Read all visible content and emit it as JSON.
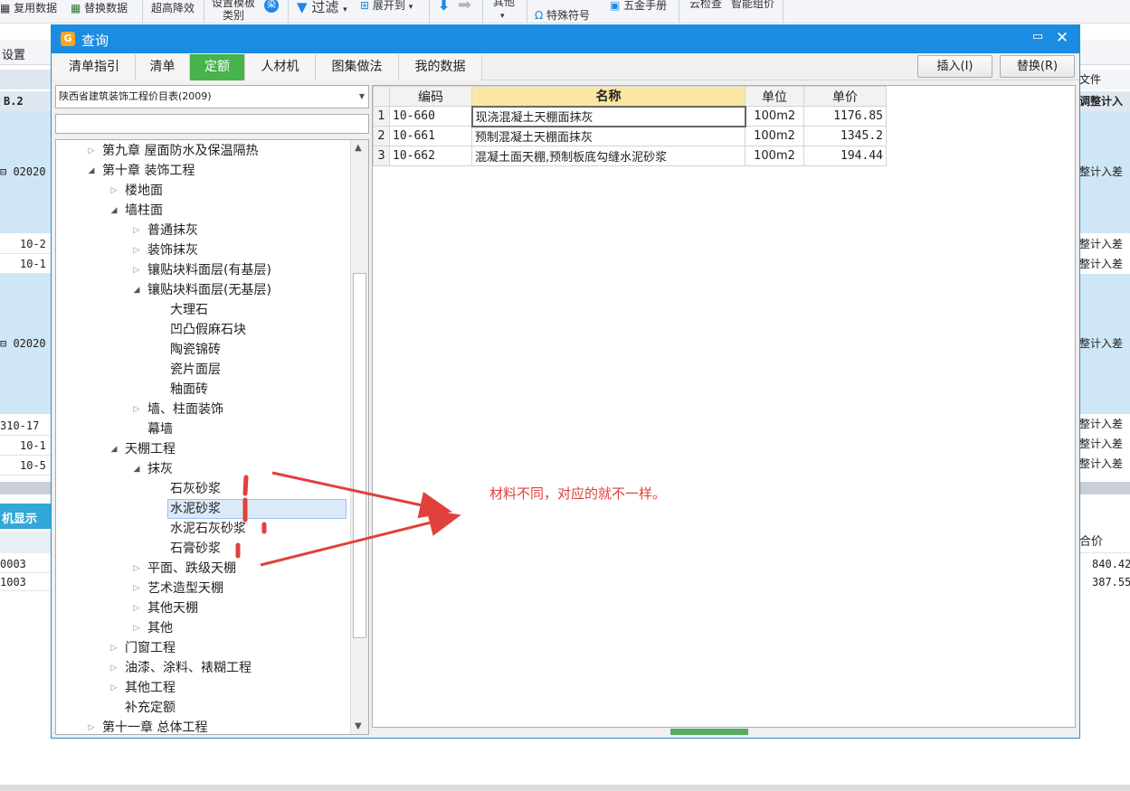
{
  "background": {
    "toolbar": {
      "items": [
        "复用数据",
        "替换数据",
        "超高降效",
        "设置模板",
        "类别",
        "过滤",
        "展开到",
        "其他",
        "特殊符号",
        "五金手册",
        "云检查",
        "智能组价"
      ]
    },
    "settings_label": "设置",
    "left_col": {
      "header_row": "B.2",
      "rows": [
        "02020",
        "10-2",
        "10-1",
        "02020",
        "310-17",
        "10-1",
        "10-5"
      ]
    },
    "right_col": {
      "header_top": "文件",
      "header_row": "调整计入",
      "rows": [
        "整计入差",
        "整计入差",
        "整计入差",
        "整计入差",
        "整计入差",
        "整计入差",
        "整计入差"
      ]
    },
    "machine_tab": "机显示",
    "bottom_left_rows": [
      "0003",
      "1003"
    ],
    "bottom_right": {
      "header": "合价",
      "values": [
        "840.42",
        "387.55"
      ]
    }
  },
  "dialog": {
    "title": "查询",
    "tabs": [
      {
        "label": "清单指引",
        "active": false
      },
      {
        "label": "清单",
        "active": false
      },
      {
        "label": "定额",
        "active": true
      },
      {
        "label": "人材机",
        "active": false
      },
      {
        "label": "图集做法",
        "active": false
      },
      {
        "label": "我的数据",
        "active": false
      }
    ],
    "buttons": {
      "insert": "插入(I)",
      "replace": "替换(R)"
    },
    "library_select": "陕西省建筑装饰工程价目表(2009)",
    "search_value": "",
    "tree": [
      {
        "label": "第九章 屋面防水及保温隔热",
        "level": 1,
        "toggle": "collapsed"
      },
      {
        "label": "第十章 装饰工程",
        "level": 1,
        "toggle": "expanded"
      },
      {
        "label": "楼地面",
        "level": 2,
        "toggle": "collapsed"
      },
      {
        "label": "墙柱面",
        "level": 2,
        "toggle": "expanded"
      },
      {
        "label": "普通抹灰",
        "level": 3,
        "toggle": "collapsed"
      },
      {
        "label": "装饰抹灰",
        "level": 3,
        "toggle": "collapsed"
      },
      {
        "label": "镶贴块料面层(有基层)",
        "level": 3,
        "toggle": "collapsed"
      },
      {
        "label": "镶贴块料面层(无基层)",
        "level": 3,
        "toggle": "expanded"
      },
      {
        "label": "大理石",
        "level": 4,
        "toggle": "none"
      },
      {
        "label": "凹凸假麻石块",
        "level": 4,
        "toggle": "none"
      },
      {
        "label": "陶瓷锦砖",
        "level": 4,
        "toggle": "none"
      },
      {
        "label": "瓷片面层",
        "level": 4,
        "toggle": "none"
      },
      {
        "label": "釉面砖",
        "level": 4,
        "toggle": "none"
      },
      {
        "label": "墙、柱面装饰",
        "level": 3,
        "toggle": "collapsed"
      },
      {
        "label": "幕墙",
        "level": 3,
        "toggle": "none"
      },
      {
        "label": "天棚工程",
        "level": 2,
        "toggle": "expanded"
      },
      {
        "label": "抹灰",
        "level": 3,
        "toggle": "expanded"
      },
      {
        "label": "石灰砂浆",
        "level": 4,
        "toggle": "none"
      },
      {
        "label": "水泥砂浆",
        "level": 4,
        "toggle": "none",
        "selected": true
      },
      {
        "label": "水泥石灰砂浆",
        "level": 4,
        "toggle": "none"
      },
      {
        "label": "石膏砂浆",
        "level": 4,
        "toggle": "none"
      },
      {
        "label": "平面、跌级天棚",
        "level": 3,
        "toggle": "collapsed"
      },
      {
        "label": "艺术造型天棚",
        "level": 3,
        "toggle": "collapsed"
      },
      {
        "label": "其他天棚",
        "level": 3,
        "toggle": "collapsed"
      },
      {
        "label": "其他",
        "level": 3,
        "toggle": "collapsed"
      },
      {
        "label": "门窗工程",
        "level": 2,
        "toggle": "collapsed"
      },
      {
        "label": "油漆、涂料、裱糊工程",
        "level": 2,
        "toggle": "collapsed"
      },
      {
        "label": "其他工程",
        "level": 2,
        "toggle": "collapsed"
      },
      {
        "label": "补充定额",
        "level": 2,
        "toggle": "none"
      },
      {
        "label": "第十一章 总体工程",
        "level": 1,
        "toggle": "collapsed"
      }
    ],
    "table": {
      "columns": [
        "编码",
        "名称",
        "单位",
        "单价"
      ],
      "rows": [
        {
          "no": "1",
          "code": "10-660",
          "name": "现浇混凝土天棚面抹灰",
          "unit": "100m2",
          "price": "1176.85"
        },
        {
          "no": "2",
          "code": "10-661",
          "name": "预制混凝土天棚面抹灰",
          "unit": "100m2",
          "price": "1345.2"
        },
        {
          "no": "3",
          "code": "10-662",
          "name": "混凝土面天棚,预制板底勾缝水泥砂浆",
          "unit": "100m2",
          "price": "194.44"
        }
      ]
    }
  },
  "annotation": {
    "text": "材料不同，对应的就不一样。",
    "color": "#e0413a"
  },
  "icons": [
    "copy-data-icon",
    "replace-data-icon",
    "filter-icon",
    "expand-icon",
    "down-arrow-icon",
    "right-arrow-icon",
    "omega-icon",
    "manual-icon",
    "dialog-app-icon",
    "maximize-icon",
    "close-icon",
    "dropdown-arrow-icon",
    "scroll-up-icon",
    "scroll-down-icon",
    "expand-node-icon",
    "collapse-node-icon"
  ]
}
